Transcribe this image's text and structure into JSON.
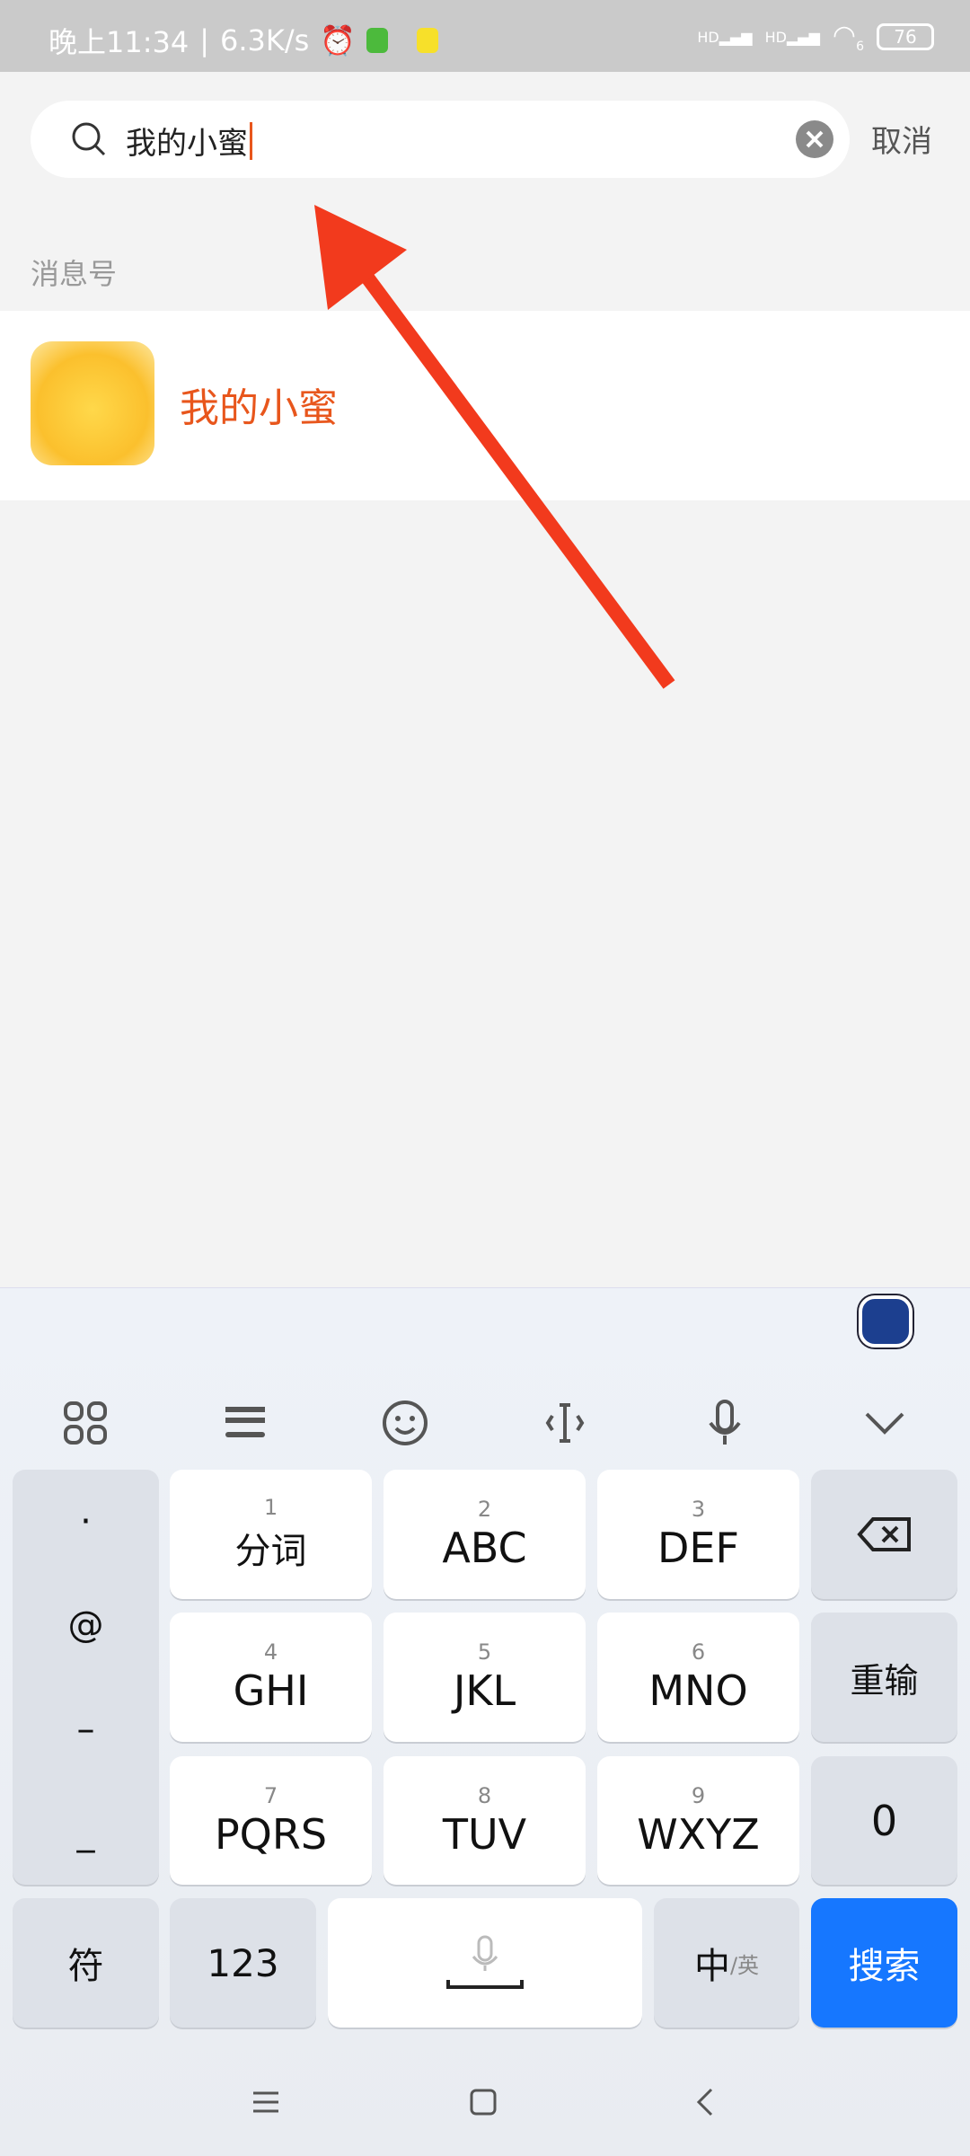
{
  "status": {
    "time": "晚上11:34",
    "speed": "6.3K/s",
    "battery": "76",
    "signal_label": "HD",
    "wifi_sub": "6"
  },
  "search": {
    "query": "我的小蜜",
    "cancel": "取消"
  },
  "results": {
    "section": "消息号",
    "items": [
      {
        "name": "我的小蜜"
      }
    ]
  },
  "keyboard": {
    "toolbar": [
      "grid-icon",
      "keyboard-icon",
      "emoji-icon",
      "cursor-icon",
      "mic-icon",
      "collapse-icon"
    ],
    "left_column": [
      "·",
      "@",
      "–",
      "_"
    ],
    "keys": [
      {
        "num": "1",
        "label": "分词"
      },
      {
        "num": "2",
        "label": "ABC"
      },
      {
        "num": "3",
        "label": "DEF"
      },
      {
        "num": "4",
        "label": "GHI"
      },
      {
        "num": "5",
        "label": "JKL"
      },
      {
        "num": "6",
        "label": "MNO"
      },
      {
        "num": "7",
        "label": "PQRS"
      },
      {
        "num": "8",
        "label": "TUV"
      },
      {
        "num": "9",
        "label": "WXYZ"
      }
    ],
    "retype": "重输",
    "zero": "0",
    "symbols": "符",
    "numbers": "123",
    "lang_main": "中",
    "lang_sub": "/英",
    "search": "搜索"
  },
  "colors": {
    "accent": "#e8561c",
    "search_key": "#1677ff",
    "arrow": "#f23a1d"
  }
}
